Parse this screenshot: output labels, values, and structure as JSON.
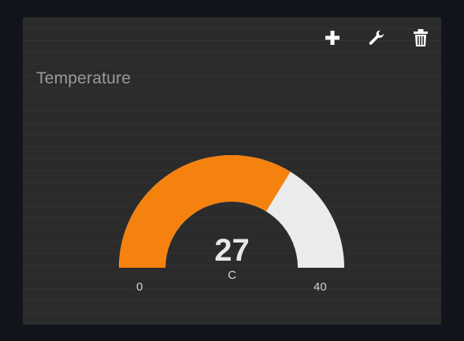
{
  "widget": {
    "title": "Temperature",
    "toolbar": {
      "add_icon": "plus-icon",
      "settings_icon": "wrench-icon",
      "delete_icon": "trash-icon"
    },
    "gauge": {
      "value": "27",
      "unit": "C",
      "min": "0",
      "max": "40",
      "fraction": 0.675,
      "fill_color": "#f5820f",
      "track_color": "#ebebeb"
    }
  },
  "colors": {
    "background": "#11151b",
    "panel": "#2b2b2b",
    "title": "#9a9a9a",
    "accent": "#f5820f"
  }
}
